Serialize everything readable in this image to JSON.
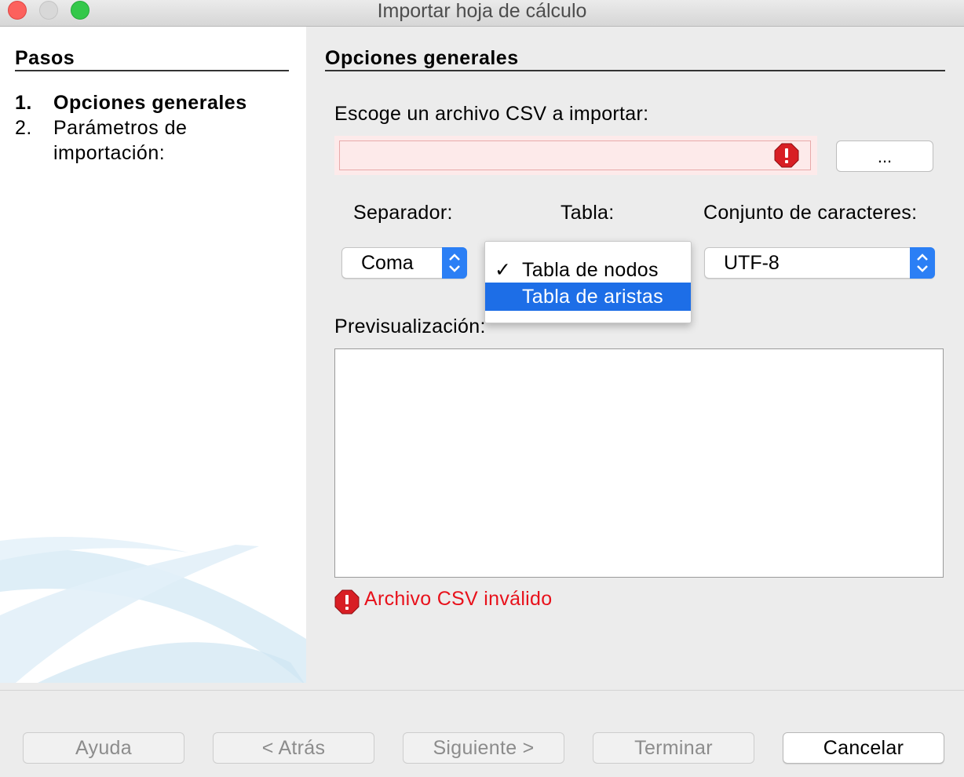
{
  "window": {
    "title": "Importar hoja de cálculo"
  },
  "steps": {
    "title": "Pasos",
    "items": [
      {
        "num": "1.",
        "label": "Opciones generales"
      },
      {
        "num": "2.",
        "label": "Parámetros de importación:"
      }
    ]
  },
  "general": {
    "title": "Opciones generales",
    "file_label": "Escoge un archivo CSV a importar:",
    "file_value": "",
    "browse_label": "...",
    "separator_label": "Separador:",
    "separator_value": "Coma",
    "table_label": "Tabla:",
    "table_options": [
      {
        "label": "Tabla de nodos",
        "checked": true
      },
      {
        "label": "Tabla de aristas",
        "highlighted": true
      }
    ],
    "charset_label": "Conjunto de caracteres:",
    "charset_value": "UTF-8",
    "preview_label": "Previsualización:",
    "error_text": "Archivo CSV inválido",
    "check_mark": "✓"
  },
  "buttons": {
    "help": "Ayuda",
    "back": "< Atrás",
    "next": "Siguiente >",
    "finish": "Terminar",
    "cancel": "Cancelar"
  },
  "colors": {
    "accent": "#1d6ee7",
    "error": "#e8111b",
    "error_field_bg": "#fdeaea"
  }
}
